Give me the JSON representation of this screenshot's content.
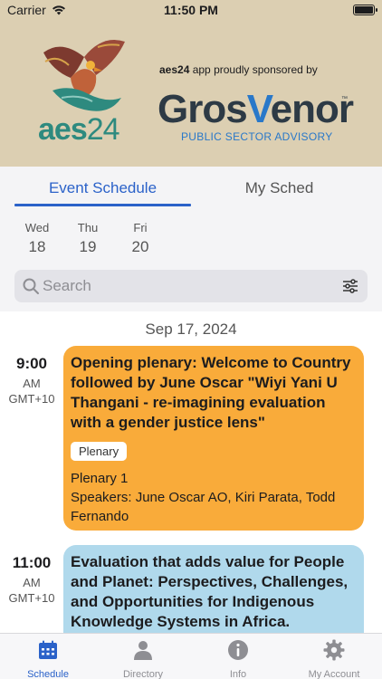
{
  "status_bar": {
    "carrier": "Carrier",
    "time": "11:50 PM"
  },
  "banner": {
    "logo_text_a": "aes",
    "logo_text_b": "24",
    "sponsor_app": "aes24",
    "sponsor_text": " app proudly sponsored by",
    "sponsor_name_a": "Gros",
    "sponsor_name_v": "V",
    "sponsor_name_b": "enor",
    "tm": "™",
    "sponsor_sub": "PUBLIC SECTOR ADVISORY"
  },
  "tabs": {
    "event_schedule": "Event Schedule",
    "my_sched": "My Sched"
  },
  "days": [
    {
      "name": "Wed",
      "num": "18"
    },
    {
      "name": "Thu",
      "num": "19"
    },
    {
      "name": "Fri",
      "num": "20"
    }
  ],
  "search": {
    "placeholder": "Search"
  },
  "schedule": {
    "date": "Sep 17, 2024",
    "sessions": [
      {
        "time": "9:00",
        "ampm": "AM",
        "tz": "GMT+10",
        "title": "Opening plenary: Welcome to Country followed by June Oscar \"Wiyi Yani U Thangani - re-imagining evaluation with a gender justice lens\"",
        "tag": "Plenary",
        "location": "Plenary 1",
        "speakers": "Speakers: June Oscar AO, Kiri Parata, Todd Fernando"
      },
      {
        "time": "11:00",
        "ampm": "AM",
        "tz": "GMT+10",
        "title": "Evaluation that adds value for People and Planet: Perspectives, Challenges, and Opportunities for Indigenous Knowledge Systems in Africa."
      }
    ]
  },
  "tabbar": [
    {
      "label": "Schedule",
      "icon": "calendar-icon"
    },
    {
      "label": "Directory",
      "icon": "people-icon"
    },
    {
      "label": "Info",
      "icon": "info-icon"
    },
    {
      "label": "My Account",
      "icon": "gear-icon"
    }
  ],
  "colors": {
    "banner": "#dccfb2",
    "accent": "#2b62c9",
    "plenary_card": "#f9ab3a",
    "session_card": "#b0d9ec"
  }
}
